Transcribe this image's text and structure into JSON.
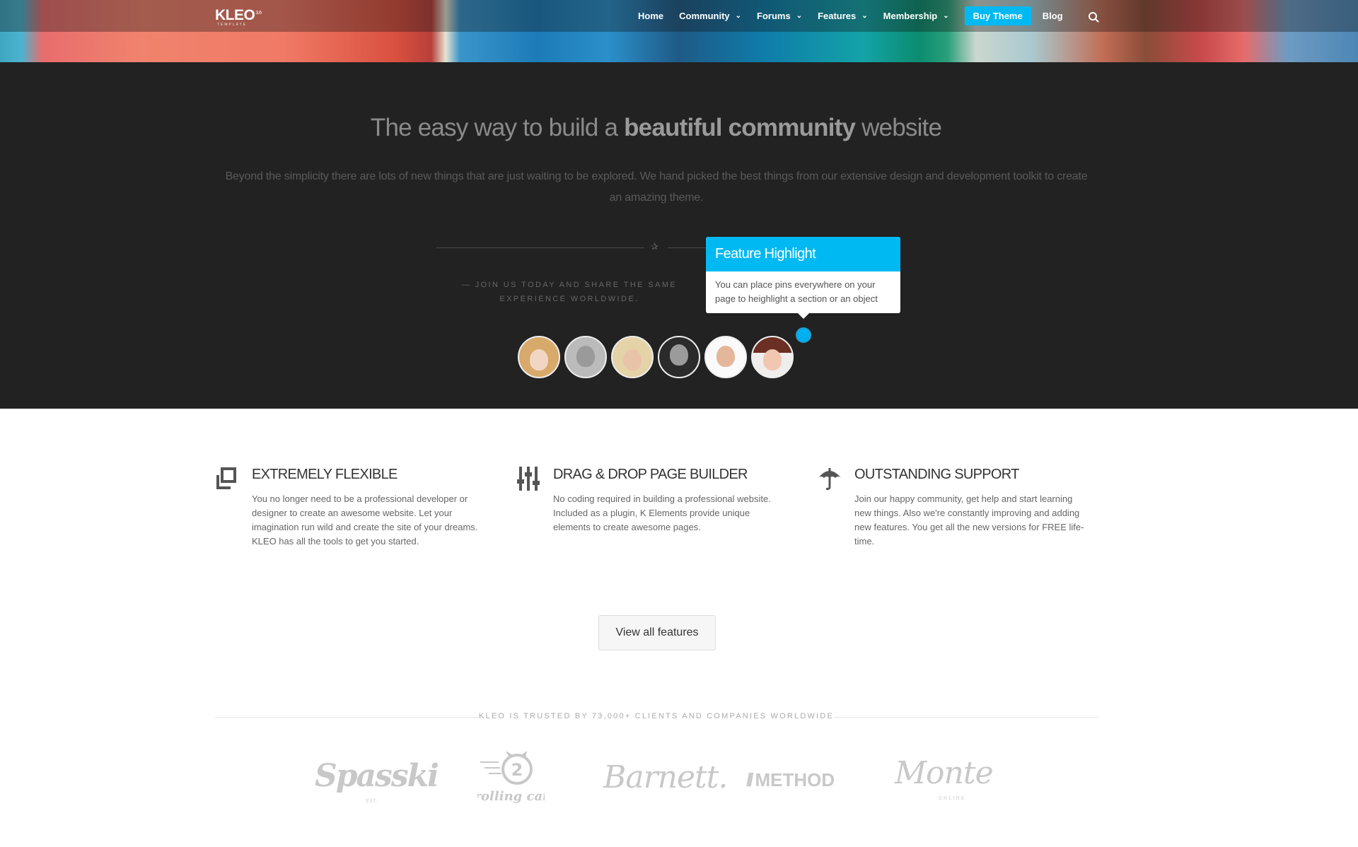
{
  "nav": {
    "logo": "KLEO",
    "logo_version": "3.6",
    "logo_sub": "TEMPLATE",
    "items": [
      {
        "label": "Home",
        "has_dropdown": false
      },
      {
        "label": "Community",
        "has_dropdown": true
      },
      {
        "label": "Forums",
        "has_dropdown": true
      },
      {
        "label": "Features",
        "has_dropdown": true
      },
      {
        "label": "Membership",
        "has_dropdown": true
      }
    ],
    "buy_label": "Buy Theme",
    "blog_label": "Blog",
    "accent_color": "#00b9f2"
  },
  "hero": {
    "headline_pre": "The easy way to build a ",
    "headline_bold": "beautiful community",
    "headline_post": " website",
    "lead": "Beyond the simplicity there are lots of new things that are just waiting to be explored. We hand picked the best things from our extensive design and development toolkit to create an amazing theme.",
    "join_text": "— JOIN US TODAY AND SHARE THE SAME EXPERIENCE WORLDWIDE.",
    "tooltip_title": "Feature Highlight",
    "tooltip_body": "You can place pins everywhere on your page to heighlight a section or an object"
  },
  "features": [
    {
      "title": "EXTREMELY FLEXIBLE",
      "text": "You no longer need to be a professional developer or designer to create an awesome website. Let your imagination run wild and create the site of your dreams. KLEO has all the tools to get you started.",
      "icon": "copy-icon"
    },
    {
      "title": "DRAG & DROP PAGE BUILDER",
      "text": "No coding required in building a professional website. Included as a plugin, K Elements provide unique elements to create awesome pages.",
      "icon": "sliders-icon"
    },
    {
      "title": "OUTSTANDING SUPPORT",
      "text": "Join our happy community, get help and start learning new things. Also we're constantly improving and adding new features. You get all the new versions for FREE life-time.",
      "icon": "umbrella-icon"
    }
  ],
  "view_all_label": "View all features",
  "trusted_text": "KLEO IS TRUSTED BY 73,000+ CLIENTS AND COMPANIES WORLDWIDE",
  "brands": {
    "spasski": "Spasski",
    "spasski_small": "EST.",
    "rolling_cat": "rolling cat",
    "rolling_cat_number": "2",
    "barnett": "Barnett.",
    "method": "METHOD",
    "monte": "Monte",
    "monte_small": "ONLINE"
  }
}
